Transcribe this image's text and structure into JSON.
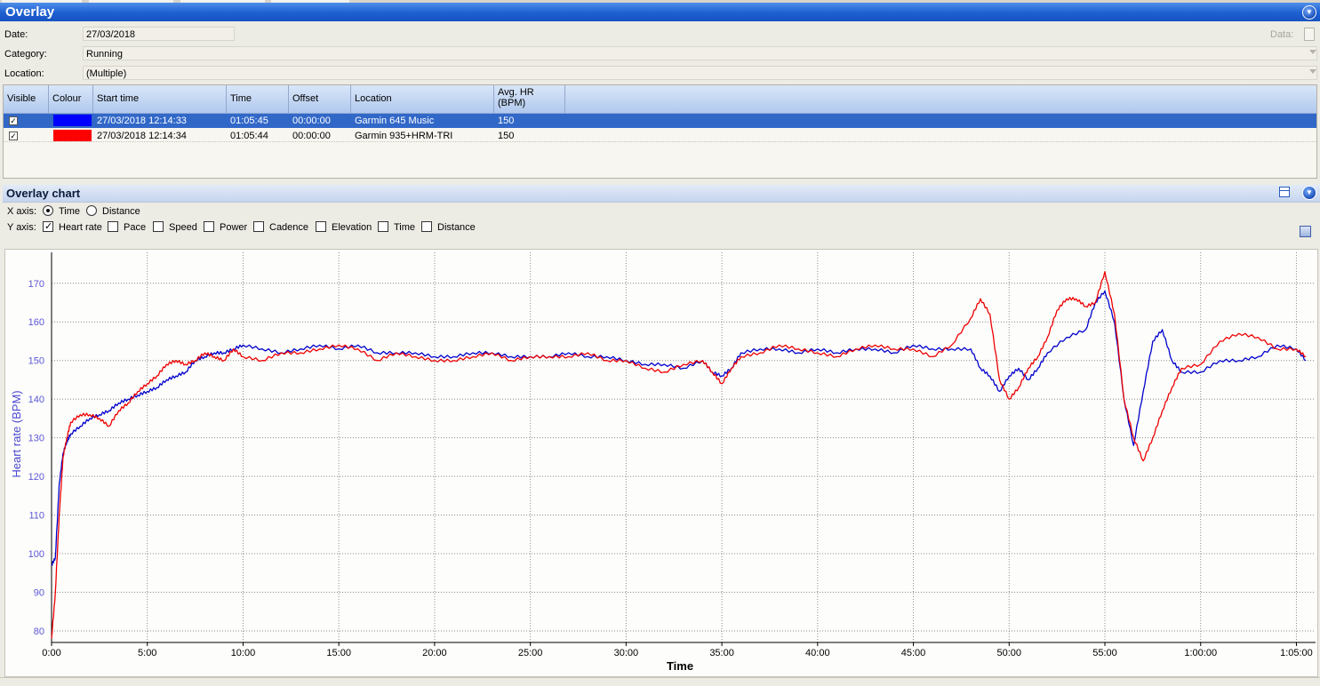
{
  "overlay": {
    "title": "Overlay",
    "date_label": "Date:",
    "date_value": "27/03/2018",
    "category_label": "Category:",
    "category_value": "Running",
    "location_label": "Location:",
    "location_value": "(Multiple)",
    "data_label": "Data:"
  },
  "grid": {
    "columns": [
      "Visible",
      "Colour",
      "Start time",
      "Time",
      "Offset",
      "Location",
      "Avg. HR (BPM)"
    ],
    "rows": [
      {
        "visible": true,
        "colour": "#0000ff",
        "start": "27/03/2018 12:14:33",
        "time": "01:05:45",
        "offset": "00:00:00",
        "location": "Garmin 645 Music",
        "avg_hr": "150",
        "selected": true
      },
      {
        "visible": true,
        "colour": "#ff0000",
        "start": "27/03/2018 12:14:34",
        "time": "01:05:44",
        "offset": "00:00:00",
        "location": "Garmin 935+HRM-TRI",
        "avg_hr": "150",
        "selected": false
      }
    ]
  },
  "chart_panel": {
    "title": "Overlay chart",
    "x_axis_label": "X axis:",
    "y_axis_label": "Y axis:",
    "x_options": [
      {
        "label": "Time",
        "selected": true
      },
      {
        "label": "Distance",
        "selected": false
      }
    ],
    "y_options": [
      {
        "label": "Heart rate",
        "checked": true
      },
      {
        "label": "Pace",
        "checked": false
      },
      {
        "label": "Speed",
        "checked": false
      },
      {
        "label": "Power",
        "checked": false
      },
      {
        "label": "Cadence",
        "checked": false
      },
      {
        "label": "Elevation",
        "checked": false
      },
      {
        "label": "Time",
        "checked": false
      },
      {
        "label": "Distance",
        "checked": false
      }
    ]
  },
  "chart_data": {
    "type": "line",
    "xlabel": "Time",
    "ylabel": "Heart rate (BPM)",
    "x_unit": "minutes",
    "xlim": [
      0,
      66
    ],
    "ylim": [
      77,
      178
    ],
    "x_ticks": [
      {
        "v": 0,
        "label": "0:00"
      },
      {
        "v": 5,
        "label": "5:00"
      },
      {
        "v": 10,
        "label": "10:00"
      },
      {
        "v": 15,
        "label": "15:00"
      },
      {
        "v": 20,
        "label": "20:00"
      },
      {
        "v": 25,
        "label": "25:00"
      },
      {
        "v": 30,
        "label": "30:00"
      },
      {
        "v": 35,
        "label": "35:00"
      },
      {
        "v": 40,
        "label": "40:00"
      },
      {
        "v": 45,
        "label": "45:00"
      },
      {
        "v": 50,
        "label": "50:00"
      },
      {
        "v": 55,
        "label": "55:00"
      },
      {
        "v": 60,
        "label": "1:00:00"
      },
      {
        "v": 65,
        "label": "1:05:00"
      }
    ],
    "y_ticks": [
      80,
      90,
      100,
      110,
      120,
      130,
      140,
      150,
      160,
      170
    ],
    "grid": true,
    "series": [
      {
        "name": "Garmin 645 Music",
        "color": "#0000cc",
        "points": [
          [
            0,
            97
          ],
          [
            0.2,
            99
          ],
          [
            0.4,
            118
          ],
          [
            0.6,
            126
          ],
          [
            0.8,
            129
          ],
          [
            1,
            131
          ],
          [
            1.5,
            133
          ],
          [
            2,
            135
          ],
          [
            2.5,
            136
          ],
          [
            3,
            137
          ],
          [
            3.5,
            139
          ],
          [
            4,
            140
          ],
          [
            4.5,
            141
          ],
          [
            5,
            142
          ],
          [
            5.5,
            143
          ],
          [
            6,
            145
          ],
          [
            6.5,
            146
          ],
          [
            7,
            147
          ],
          [
            7.5,
            150
          ],
          [
            8,
            151
          ],
          [
            8.5,
            152
          ],
          [
            9,
            152
          ],
          [
            9.5,
            153
          ],
          [
            10,
            154
          ],
          [
            11,
            153
          ],
          [
            12,
            152
          ],
          [
            13,
            153
          ],
          [
            14,
            154
          ],
          [
            15,
            153
          ],
          [
            16,
            154
          ],
          [
            17,
            152
          ],
          [
            18,
            152
          ],
          [
            19,
            152
          ],
          [
            20,
            151
          ],
          [
            21,
            151
          ],
          [
            22,
            152
          ],
          [
            23,
            152
          ],
          [
            24,
            151
          ],
          [
            25,
            151
          ],
          [
            26,
            151
          ],
          [
            27,
            152
          ],
          [
            28,
            151
          ],
          [
            29,
            151
          ],
          [
            30,
            150
          ],
          [
            31,
            149
          ],
          [
            32,
            149
          ],
          [
            33,
            148
          ],
          [
            34,
            150
          ],
          [
            34.5,
            147
          ],
          [
            35,
            146
          ],
          [
            35.5,
            148
          ],
          [
            36,
            152
          ],
          [
            37,
            153
          ],
          [
            38,
            153
          ],
          [
            39,
            152
          ],
          [
            40,
            153
          ],
          [
            41,
            152
          ],
          [
            42,
            153
          ],
          [
            43,
            153
          ],
          [
            44,
            152
          ],
          [
            45,
            154
          ],
          [
            46,
            153
          ],
          [
            47,
            153
          ],
          [
            48,
            153
          ],
          [
            48.5,
            148
          ],
          [
            49,
            146
          ],
          [
            49.5,
            142
          ],
          [
            50,
            146
          ],
          [
            50.5,
            148
          ],
          [
            51,
            145
          ],
          [
            51.5,
            148
          ],
          [
            52,
            152
          ],
          [
            53,
            156
          ],
          [
            54,
            158
          ],
          [
            54.5,
            165
          ],
          [
            55,
            168
          ],
          [
            55.5,
            160
          ],
          [
            56,
            140
          ],
          [
            56.5,
            128
          ],
          [
            57,
            142
          ],
          [
            57.5,
            155
          ],
          [
            58,
            158
          ],
          [
            58.5,
            150
          ],
          [
            59,
            147
          ],
          [
            60,
            147
          ],
          [
            61,
            150
          ],
          [
            62,
            150
          ],
          [
            63,
            151
          ],
          [
            64,
            154
          ],
          [
            65,
            153
          ],
          [
            65.5,
            150
          ]
        ]
      },
      {
        "name": "Garmin 935+HRM-TRI",
        "color": "#ee0000",
        "points": [
          [
            0,
            78
          ],
          [
            0.2,
            90
          ],
          [
            0.4,
            110
          ],
          [
            0.6,
            125
          ],
          [
            0.8,
            130
          ],
          [
            1,
            134
          ],
          [
            1.5,
            136
          ],
          [
            2,
            136
          ],
          [
            2.5,
            135
          ],
          [
            3,
            133
          ],
          [
            3.5,
            137
          ],
          [
            4,
            139
          ],
          [
            4.5,
            142
          ],
          [
            5,
            144
          ],
          [
            5.5,
            146
          ],
          [
            6,
            149
          ],
          [
            6.5,
            150
          ],
          [
            7,
            149
          ],
          [
            7.5,
            150
          ],
          [
            8,
            152
          ],
          [
            8.5,
            151
          ],
          [
            9,
            150
          ],
          [
            9.5,
            153
          ],
          [
            10,
            151
          ],
          [
            11,
            150
          ],
          [
            12,
            152
          ],
          [
            13,
            152
          ],
          [
            14,
            153
          ],
          [
            15,
            154
          ],
          [
            16,
            153
          ],
          [
            17,
            150
          ],
          [
            18,
            152
          ],
          [
            19,
            151
          ],
          [
            20,
            150
          ],
          [
            21,
            150
          ],
          [
            22,
            151
          ],
          [
            23,
            152
          ],
          [
            24,
            150
          ],
          [
            25,
            151
          ],
          [
            26,
            151
          ],
          [
            27,
            151
          ],
          [
            28,
            152
          ],
          [
            29,
            150
          ],
          [
            30,
            150
          ],
          [
            31,
            148
          ],
          [
            32,
            147
          ],
          [
            33,
            149
          ],
          [
            34,
            150
          ],
          [
            34.5,
            147
          ],
          [
            35,
            144
          ],
          [
            35.5,
            148
          ],
          [
            36,
            151
          ],
          [
            37,
            152
          ],
          [
            38,
            154
          ],
          [
            39,
            153
          ],
          [
            40,
            152
          ],
          [
            41,
            151
          ],
          [
            42,
            153
          ],
          [
            43,
            154
          ],
          [
            44,
            153
          ],
          [
            45,
            153
          ],
          [
            46,
            151
          ],
          [
            47,
            154
          ],
          [
            48,
            161
          ],
          [
            48.5,
            166
          ],
          [
            49,
            162
          ],
          [
            49.5,
            145
          ],
          [
            50,
            140
          ],
          [
            50.5,
            143
          ],
          [
            51,
            148
          ],
          [
            51.5,
            151
          ],
          [
            52,
            156
          ],
          [
            52.5,
            163
          ],
          [
            53,
            166
          ],
          [
            53.5,
            166
          ],
          [
            54,
            164
          ],
          [
            54.5,
            165
          ],
          [
            55,
            173
          ],
          [
            55.5,
            162
          ],
          [
            56,
            140
          ],
          [
            56.5,
            130
          ],
          [
            57,
            124
          ],
          [
            57.5,
            130
          ],
          [
            58,
            137
          ],
          [
            58.5,
            143
          ],
          [
            59,
            148
          ],
          [
            60,
            149
          ],
          [
            61,
            155
          ],
          [
            62,
            157
          ],
          [
            63,
            156
          ],
          [
            64,
            153
          ],
          [
            65,
            153
          ],
          [
            65.5,
            151
          ]
        ]
      }
    ]
  }
}
